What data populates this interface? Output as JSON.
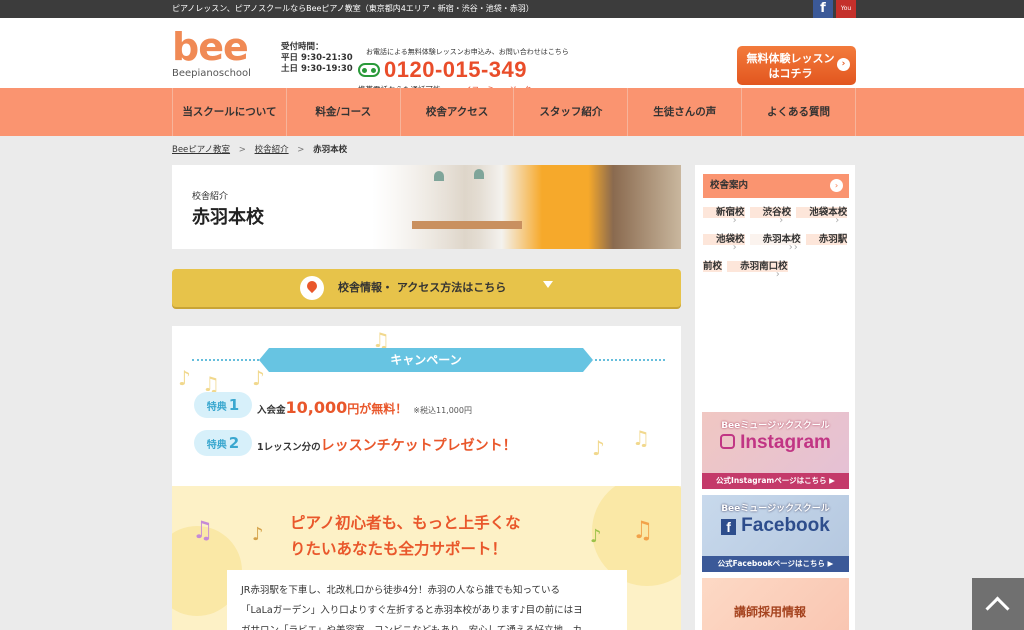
{
  "topbar": {
    "tagline": "ピアノレッスン、ピアノスクールならBeeピアノ教室（東京都内4エリア・新宿・渋谷・池袋・赤羽）",
    "facebook_label": "f",
    "youtube_label": "You Tube"
  },
  "header": {
    "logo_main": "bee",
    "logo_sub": "Beepianoschool",
    "hours_label": "受付時間：",
    "hours_weekday": "平日 9:30-21:30",
    "hours_weekend": "土日 9:30-19:30",
    "tel_note": "お電話による無料体験レッスンお申込み、お問い合わせはこちら",
    "tel_number": "0120-015-349",
    "tel_sub": "携帯電話からも通話可能",
    "tel_kana": "イコーミュージック",
    "cta_line1": "無料体験レッスン",
    "cta_line2": "はコチラ"
  },
  "nav": {
    "items": [
      {
        "label": "当スクールについて"
      },
      {
        "label": "料金/コース"
      },
      {
        "label": "校舎アクセス"
      },
      {
        "label": "スタッフ紹介"
      },
      {
        "label": "生徒さんの声"
      },
      {
        "label": "よくある質問"
      }
    ]
  },
  "breadcrumb": {
    "home": "Beeピアノ教室",
    "parent": "校舎紹介",
    "current": "赤羽本校",
    "sep": ">"
  },
  "hero": {
    "subtitle": "校舎紹介",
    "title": "赤羽本校"
  },
  "access_bar": {
    "label": "校舎情報・ アクセス方法はこちら"
  },
  "campaign": {
    "ribbon": "キャンペーン",
    "perk_word": "特典",
    "perk1_num": "1",
    "perk1_pre": "入会金",
    "perk1_price": "10,000",
    "perk1_yen": "円が",
    "perk1_free": "無料！",
    "perk1_tax": "※税込11,000円",
    "perk2_num": "2",
    "perk2_pre": "1レッスン分の",
    "perk2_main": "レッスンチケットプレゼント！"
  },
  "support": {
    "headline_line1": "ピアノ初心者も、もっと上手くな",
    "headline_line2": "りたいあなたも全力サポート！",
    "body_line1": "JR赤羽駅を下車し、北改札口から徒歩4分！赤羽の人なら誰でも知っている",
    "body_line2": "「LaLaガーデン」入り口よりすぐ左折すると赤羽本校があります♪目の前にはヨ",
    "body_line3": "ガサロン「ラビエ」や美容室、コンビニなどもあり、安心して通える好立地、カ"
  },
  "sidebar": {
    "heading": "校舎案内",
    "items": [
      {
        "label": "新宿校"
      },
      {
        "label": "渋谷校"
      },
      {
        "label": "池袋本校"
      },
      {
        "label": "池袋校"
      },
      {
        "label": "赤羽本校"
      },
      {
        "label": "赤羽駅前校"
      },
      {
        "label": "赤羽南口校"
      }
    ],
    "instagram": {
      "caption": "Beeミュージックスクール",
      "title": "Instagram",
      "footer": "公式Instagramページはこちら ▶"
    },
    "facebook": {
      "caption": "Beeミュージックスクール",
      "title": "Facebook",
      "footer": "公式Facebookページはこちら ▶"
    },
    "recruit": {
      "title": "講師採用情報"
    }
  },
  "colors": {
    "accent_orange": "#fa9470",
    "cta_orange": "#e2561f",
    "gold_bar": "#e7c34a",
    "sky_blue": "#67c4e2",
    "red_text": "#e9572b"
  }
}
